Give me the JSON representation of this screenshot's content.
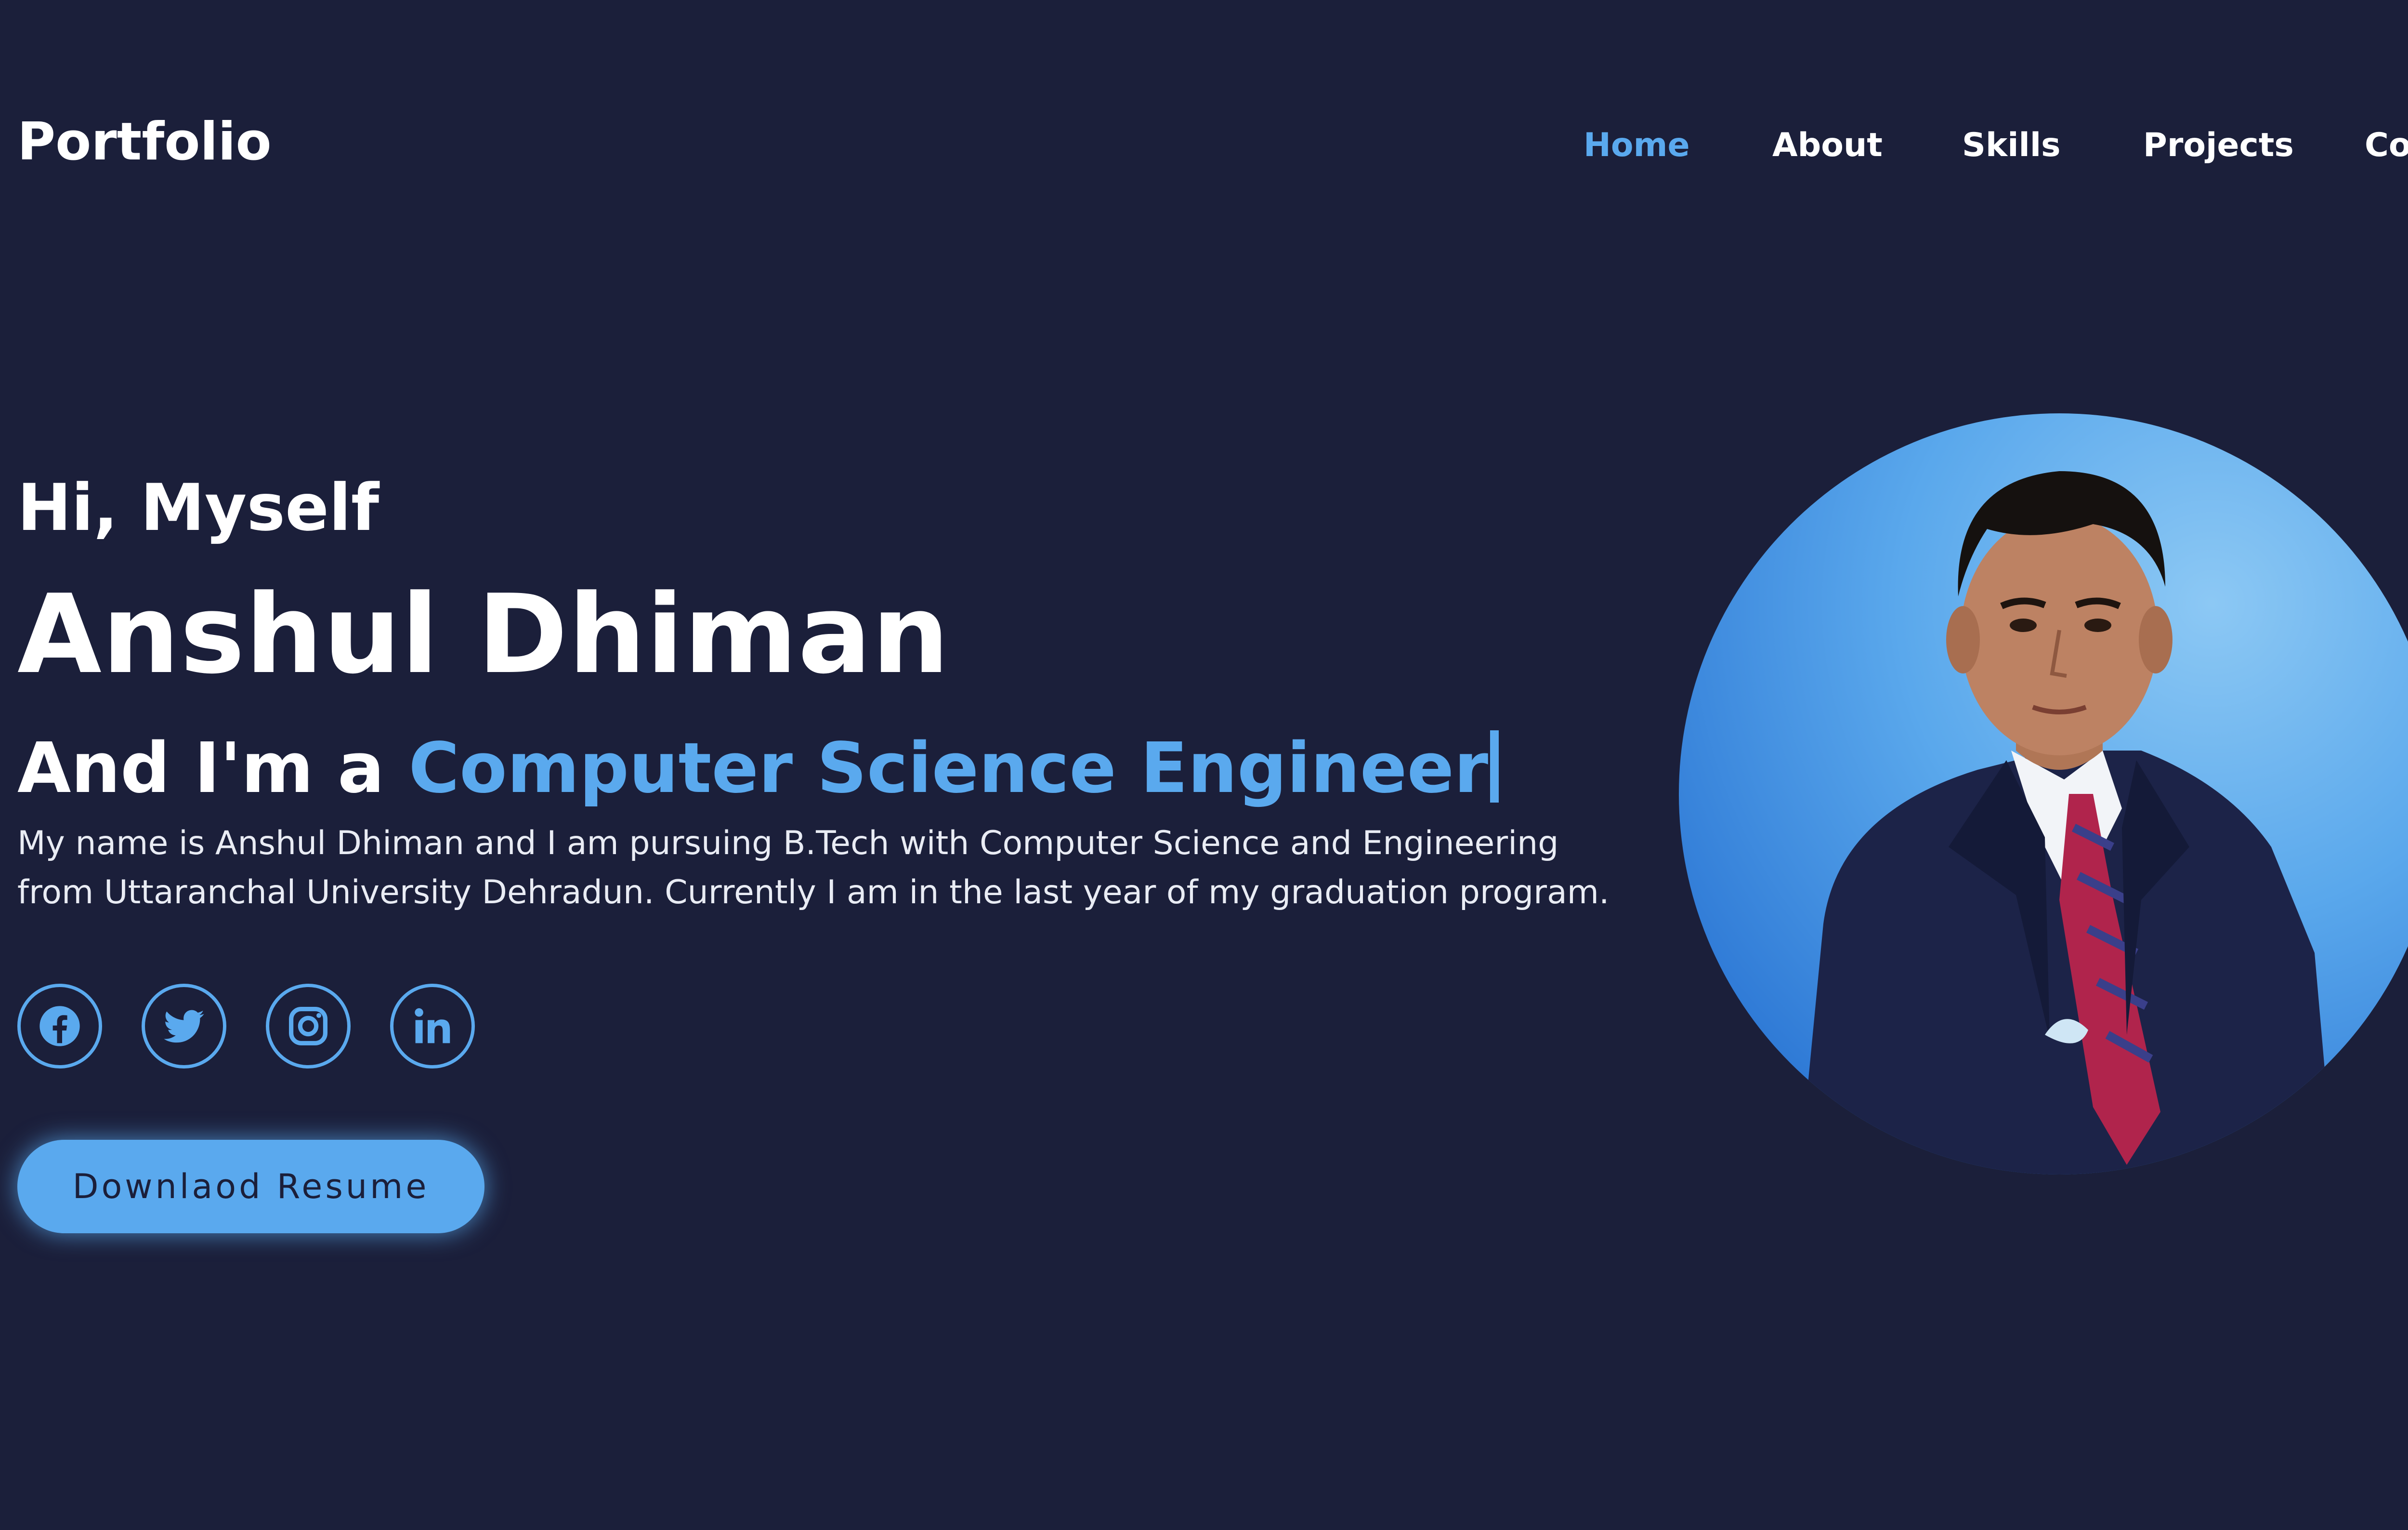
{
  "header": {
    "logo": "Portfolio",
    "nav": [
      {
        "label": "Home",
        "active": true
      },
      {
        "label": "About",
        "active": false
      },
      {
        "label": "Skills",
        "active": false
      },
      {
        "label": "Projects",
        "active": false
      },
      {
        "label": "Cont",
        "active": false
      }
    ]
  },
  "hero": {
    "greeting": "Hi, Myself",
    "name": "Anshul Dhiman",
    "role_prefix": "And I'm a",
    "role": "Computer Science Engineer",
    "bio": "My name is Anshul Dhiman and I am pursuing B.Tech with Computer Science and Engineering from Uttaranchal University Dehradun. Currently I am in the last year of my graduation program.",
    "socials": [
      {
        "icon": "facebook-icon"
      },
      {
        "icon": "twitter-icon"
      },
      {
        "icon": "instagram-icon"
      },
      {
        "icon": "linkedin-icon"
      }
    ],
    "resume_button": "Downlaod Resume"
  },
  "colors": {
    "background": "#1b1f3a",
    "accent": "#5aa9ee",
    "text": "#ffffff"
  }
}
